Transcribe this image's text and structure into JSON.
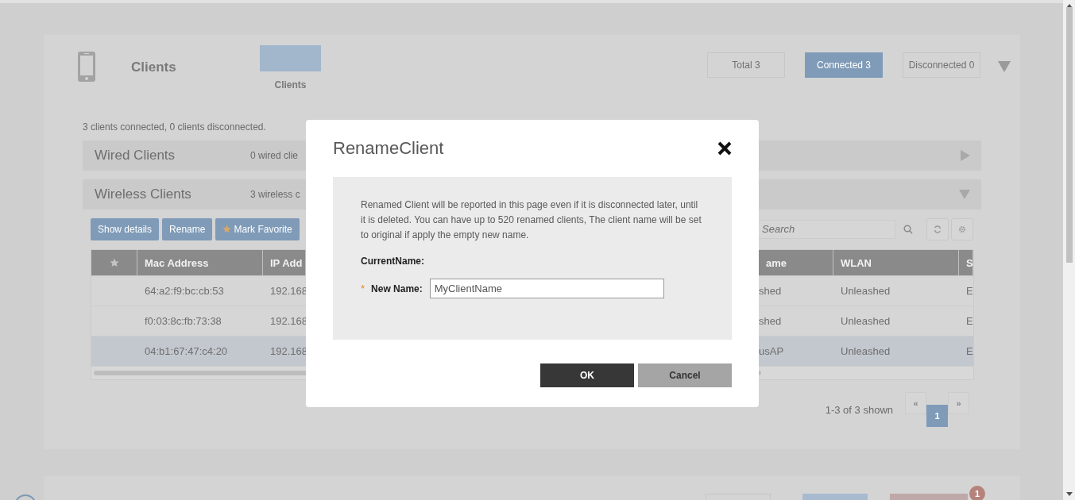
{
  "header": {
    "title": "Clients",
    "tile_label": "Clients",
    "filters": [
      {
        "label": "Total 3",
        "selected": false
      },
      {
        "label": "Connected 3",
        "selected": true
      },
      {
        "label": "Disconnected 0",
        "selected": false
      }
    ]
  },
  "summary": "3 clients connected, 0 clients disconnected.",
  "sections": [
    {
      "title": "Wired Clients",
      "summary": "0 wired clie",
      "expanded": false
    },
    {
      "title": "Wireless Clients",
      "summary": "3 wireless c",
      "expanded": true
    }
  ],
  "toolbar": {
    "buttons": [
      {
        "label": "Show details",
        "kind": "plain"
      },
      {
        "label": "Rename",
        "kind": "plain"
      },
      {
        "label": "Mark Favorite",
        "kind": "favorite"
      }
    ],
    "search": {
      "placeholder": "Search"
    }
  },
  "table": {
    "columns": [
      {
        "kind": "star"
      },
      {
        "kind": "text",
        "label": "Mac Address"
      },
      {
        "kind": "text",
        "label": "IP Add"
      },
      {
        "kind": "text",
        "label": "ame"
      },
      {
        "kind": "text",
        "label": "WLAN"
      },
      {
        "kind": "text",
        "label": "S"
      }
    ],
    "rows": [
      {
        "selected": false,
        "cells": [
          "",
          "64:a2:f9:bc:cb:53",
          "192.168",
          "shed",
          "Unleashed",
          "E"
        ]
      },
      {
        "selected": false,
        "cells": [
          "",
          "f0:03:8c:fb:73:38",
          "192.168",
          "shed",
          "Unleashed",
          "E"
        ]
      },
      {
        "selected": true,
        "cells": [
          "",
          "04:b1:67:47:c4:20",
          "192.168",
          "usAP",
          "Unleashed",
          "E"
        ]
      }
    ]
  },
  "pagination": {
    "summary": "1-3 of 3 shown",
    "prev": "«",
    "next": "»",
    "pages": [
      {
        "label": "1",
        "selected": true
      }
    ]
  },
  "dialog": {
    "title": "RenameClient",
    "message": "Renamed Client will be reported in this page even if it is disconnected later, until it is deleted. You can have up to 520 renamed clients, The client name will be set to original if apply the empty new name.",
    "current_name_label": "CurrentName:",
    "required_mark": "*",
    "new_name_label": "New Name:",
    "new_name_value": "MyClientName",
    "buttons": [
      {
        "label": "OK",
        "kind": "primary"
      },
      {
        "label": "Cancel",
        "kind": "secondary"
      }
    ]
  },
  "next_panel": {
    "badge": "1"
  }
}
